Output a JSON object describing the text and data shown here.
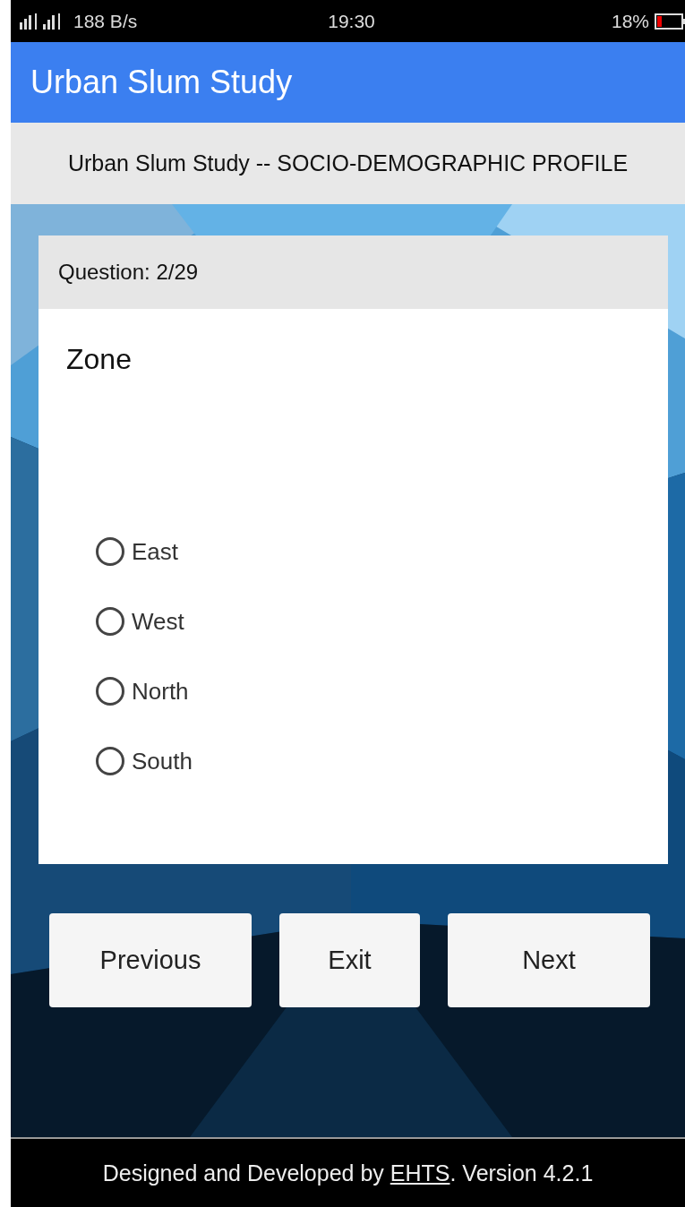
{
  "status_bar": {
    "speed": "188 B/s",
    "time": "19:30",
    "battery": "18%"
  },
  "app_bar": {
    "title": "Urban Slum Study"
  },
  "survey_title": "Urban Slum Study -- SOCIO-DEMOGRAPHIC PROFILE",
  "question": {
    "counter": "Question: 2/29",
    "text": "Zone",
    "options": [
      {
        "label": "East",
        "selected": false
      },
      {
        "label": "West",
        "selected": false
      },
      {
        "label": "North",
        "selected": false
      },
      {
        "label": "South",
        "selected": false
      }
    ]
  },
  "buttons": [
    "Previous",
    "Exit",
    "Next"
  ],
  "footer": {
    "before": "Designed and Developed by ",
    "link": "EHTS",
    "after": ". Version 4.2.1"
  }
}
